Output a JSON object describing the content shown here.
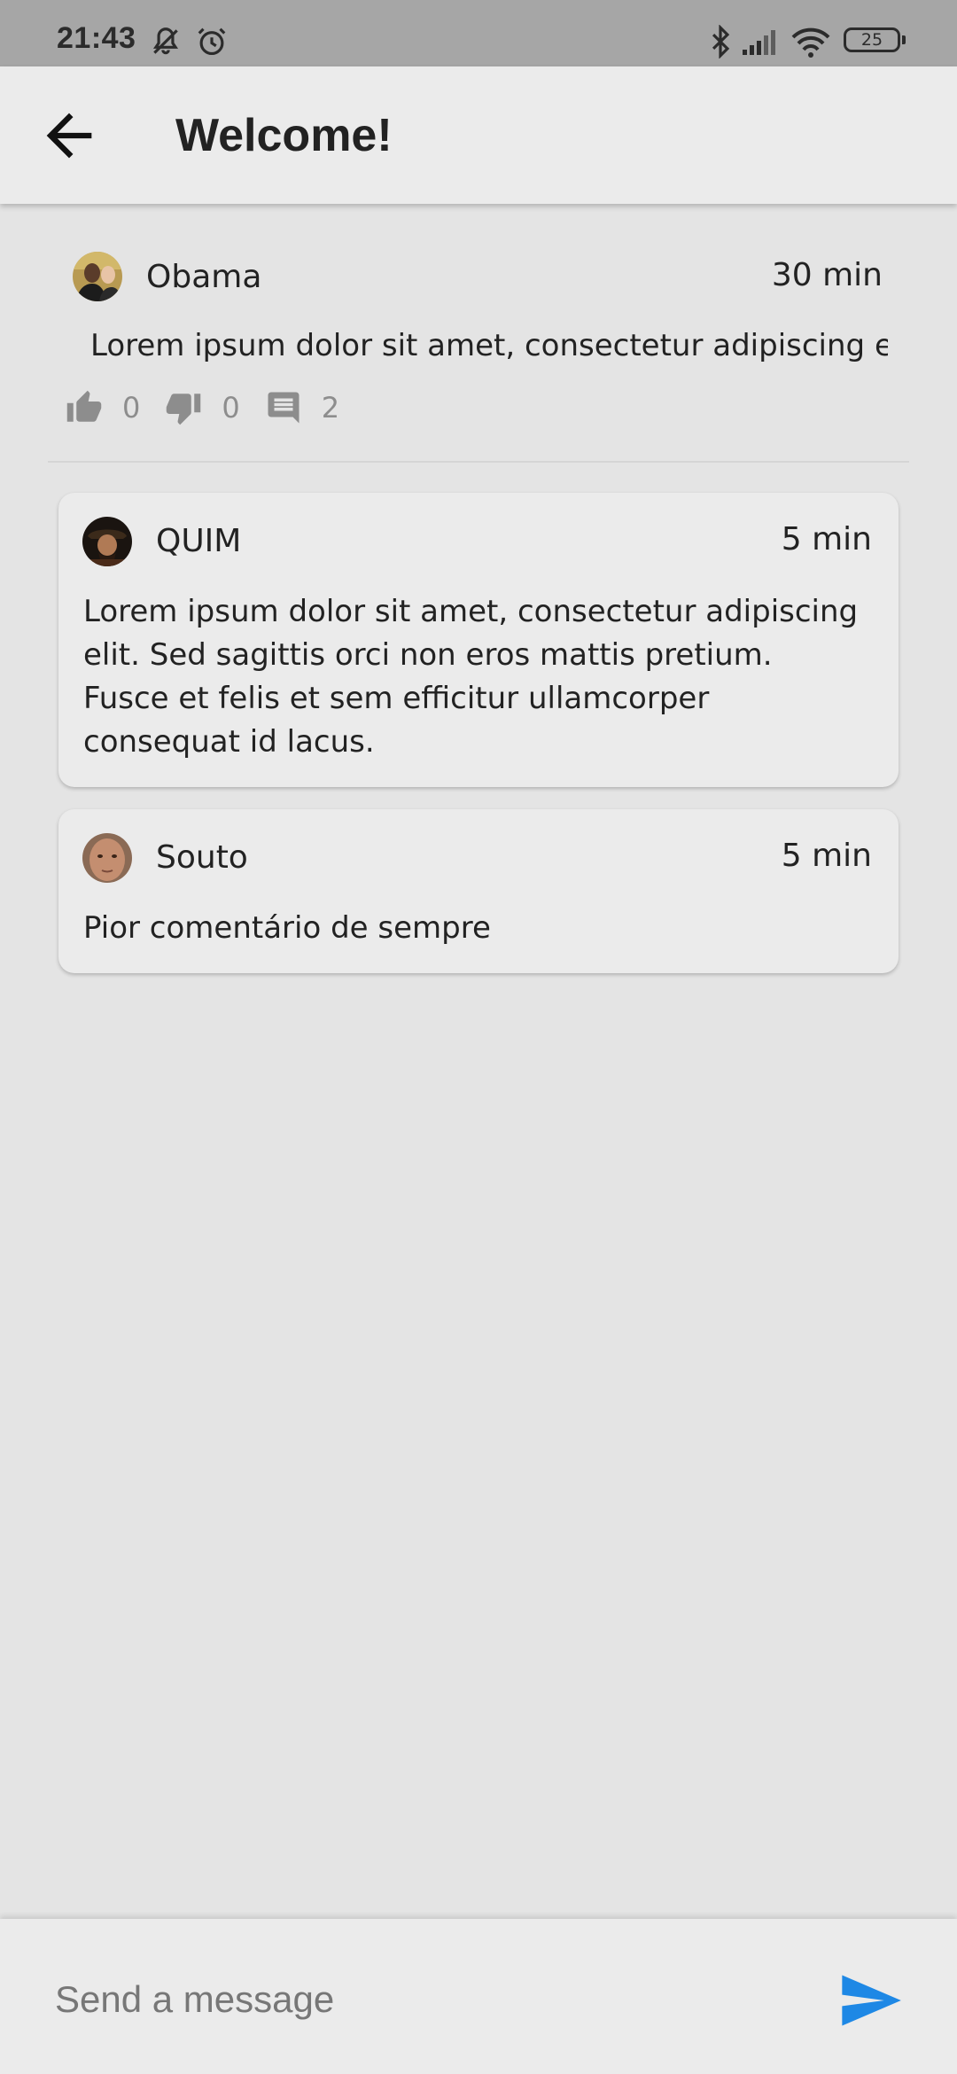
{
  "status_bar": {
    "time": "21:43",
    "battery": "25"
  },
  "header": {
    "title": "Welcome!"
  },
  "post": {
    "author": "Obama",
    "time": "30 min",
    "text": "Lorem ipsum dolor sit amet, consectetur adipiscing eli",
    "likes": "0",
    "dislikes": "0",
    "comments": "2"
  },
  "comments": [
    {
      "author": "QUIM",
      "time": "5 min",
      "text": "Lorem ipsum dolor sit amet, consectetur adipiscing elit. Sed sagittis orci non eros mattis pretium. Fusce et felis et sem efficitur ullamcorper consequat id lacus."
    },
    {
      "author": "Souto",
      "time": "5 min",
      "text": "Pior comentário de sempre"
    }
  ],
  "composer": {
    "placeholder": "Send a message"
  },
  "colors": {
    "accent": "#1e88e5",
    "status_bar": "#a6a6a6",
    "background": "#e4e4e4",
    "surface": "#ebebeb"
  },
  "icons": [
    "back-arrow-icon",
    "thumb-up-icon",
    "thumb-down-icon",
    "comment-icon",
    "send-icon",
    "bluetooth-icon",
    "signal-icon",
    "wifi-icon",
    "battery-icon",
    "mute-icon",
    "alarm-icon"
  ]
}
